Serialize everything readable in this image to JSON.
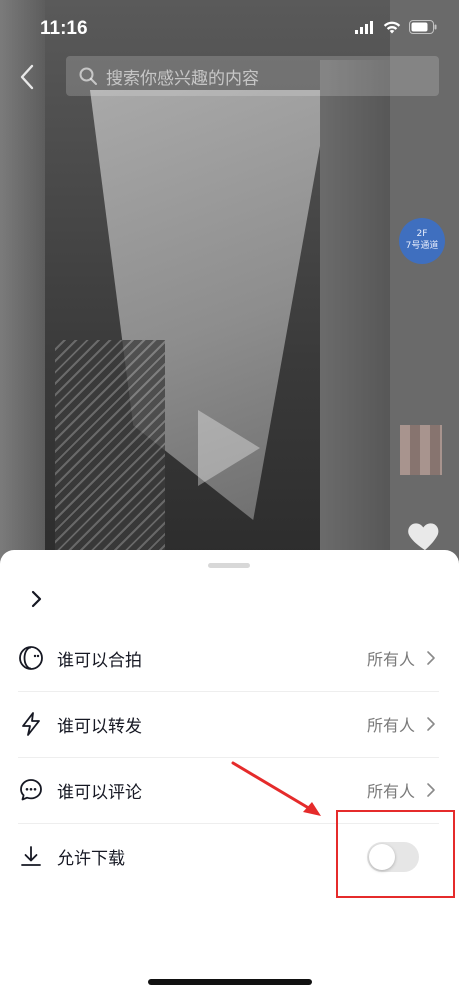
{
  "status_bar": {
    "time": "11:16"
  },
  "search": {
    "placeholder": "搜索你感兴趣的内容"
  },
  "video": {
    "sign_line1": "2F",
    "sign_line2": "7号通道"
  },
  "sheet": {
    "rows": [
      {
        "label": "谁可以合拍",
        "value": "所有人",
        "icon": "duet-icon"
      },
      {
        "label": "谁可以转发",
        "value": "所有人",
        "icon": "lightning-icon"
      },
      {
        "label": "谁可以评论",
        "value": "所有人",
        "icon": "comment-icon"
      }
    ],
    "download": {
      "label": "允许下载",
      "enabled": false,
      "icon": "download-icon"
    }
  },
  "colors": {
    "annotation_red": "#e52b2b",
    "toggle_off": "#e6e6e6",
    "text_primary": "#161823"
  }
}
